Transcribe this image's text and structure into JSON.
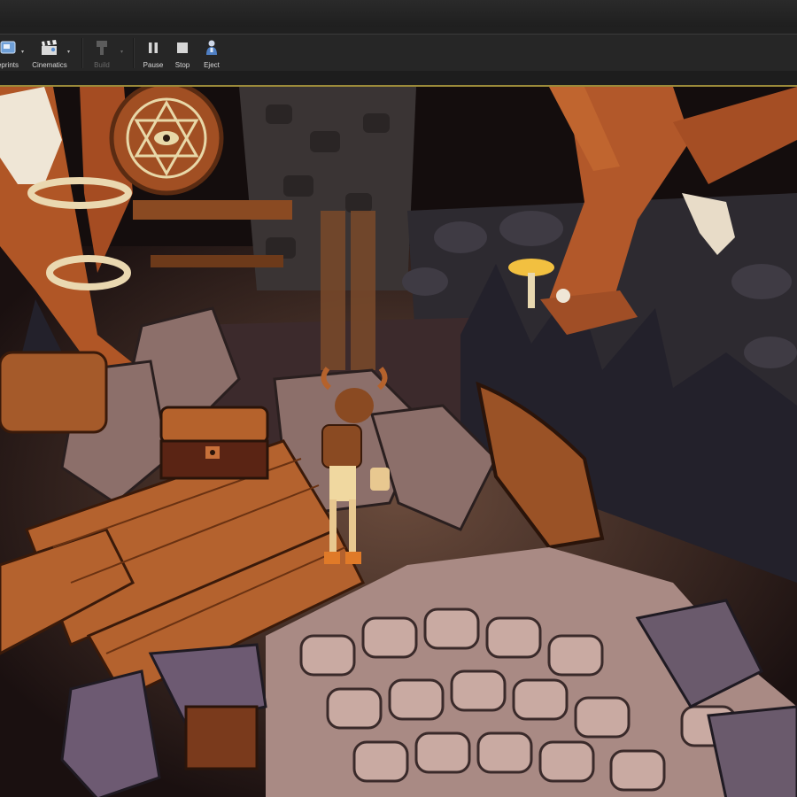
{
  "toolbar": {
    "blueprints_label": "eprints",
    "cinematics_label": "Cinematics",
    "build_label": "Build",
    "pause_label": "Pause",
    "stop_label": "Stop",
    "eject_label": "Eject"
  },
  "icons": {
    "blueprints": "blueprints-icon",
    "cinematics": "clapperboard-icon",
    "build": "build-icon",
    "pause": "pause-icon",
    "stop": "stop-icon",
    "eject": "eject-icon"
  },
  "colors": {
    "viewport_border": "#9b8a3a",
    "toolbar_bg": "#262626"
  }
}
